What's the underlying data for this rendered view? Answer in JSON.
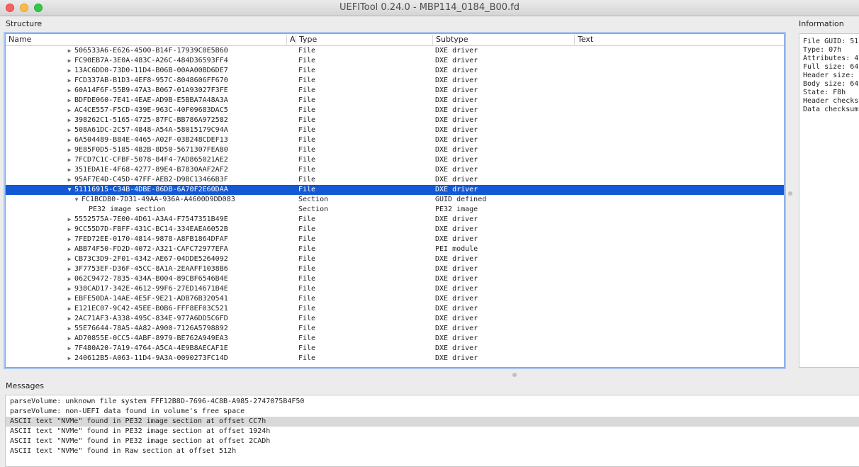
{
  "window": {
    "title": "UEFITool 0.24.0 - MBP114_0184_B00.fd"
  },
  "structure": {
    "title": "Structure",
    "columns": {
      "name": "Name",
      "a": "A",
      "type": "Type",
      "subtype": "Subtype",
      "text": "Text"
    },
    "rows": [
      {
        "name": "506533A6-E626-4500-B14F-17939C0E5B60",
        "type": "File",
        "subtype": "DXE driver",
        "level": 0,
        "arrow": "right"
      },
      {
        "name": "FC90EB7A-3E0A-483C-A26C-484D36593FF4",
        "type": "File",
        "subtype": "DXE driver",
        "level": 0,
        "arrow": "right"
      },
      {
        "name": "13AC6DD0-73D0-11D4-B06B-00AA00BD6DE7",
        "type": "File",
        "subtype": "DXE driver",
        "level": 0,
        "arrow": "right"
      },
      {
        "name": "FCD337AB-B1D3-4EF8-957C-8048606FF670",
        "type": "File",
        "subtype": "DXE driver",
        "level": 0,
        "arrow": "right"
      },
      {
        "name": "60A14F6F-55B9-47A3-B067-01A93027F3FE",
        "type": "File",
        "subtype": "DXE driver",
        "level": 0,
        "arrow": "right"
      },
      {
        "name": "BDFDE060-7E41-4EAE-AD9B-E5BBA7A48A3A",
        "type": "File",
        "subtype": "DXE driver",
        "level": 0,
        "arrow": "right"
      },
      {
        "name": "AC4CE557-F5CD-439E-963C-40F09683DAC5",
        "type": "File",
        "subtype": "DXE driver",
        "level": 0,
        "arrow": "right"
      },
      {
        "name": "398262C1-5165-4725-87FC-BB786A972582",
        "type": "File",
        "subtype": "DXE driver",
        "level": 0,
        "arrow": "right"
      },
      {
        "name": "508A61DC-2C57-4848-A54A-58015179C94A",
        "type": "File",
        "subtype": "DXE driver",
        "level": 0,
        "arrow": "right"
      },
      {
        "name": "6A504489-B84E-4465-A02F-03B248CDEF13",
        "type": "File",
        "subtype": "DXE driver",
        "level": 0,
        "arrow": "right"
      },
      {
        "name": "9E85F0D5-5185-482B-8D50-5671307FEA80",
        "type": "File",
        "subtype": "DXE driver",
        "level": 0,
        "arrow": "right"
      },
      {
        "name": "7FCD7C1C-CFBF-5078-84F4-7AD865021AE2",
        "type": "File",
        "subtype": "DXE driver",
        "level": 0,
        "arrow": "right"
      },
      {
        "name": "351EDA1E-4F68-4277-89E4-B7830AAF2AF2",
        "type": "File",
        "subtype": "DXE driver",
        "level": 0,
        "arrow": "right"
      },
      {
        "name": "95AF7E4D-C45D-47FF-AEB2-D9BC13466B3F",
        "type": "File",
        "subtype": "DXE driver",
        "level": 0,
        "arrow": "right"
      },
      {
        "name": "51116915-C34B-4DBE-86DB-6A70F2E60DAA",
        "type": "File",
        "subtype": "DXE driver",
        "level": 0,
        "arrow": "down",
        "selected": true
      },
      {
        "name": "FC1BCDB0-7D31-49AA-936A-A4600D9DD083",
        "type": "Section",
        "subtype": "GUID defined",
        "level": 1,
        "arrow": "down"
      },
      {
        "name": "PE32 image section",
        "type": "Section",
        "subtype": "PE32 image",
        "level": 2,
        "arrow": "none"
      },
      {
        "name": "5552575A-7E00-4D61-A3A4-F7547351B49E",
        "type": "File",
        "subtype": "DXE driver",
        "level": 0,
        "arrow": "right"
      },
      {
        "name": "9CC55D7D-FBFF-431C-BC14-334EAEA6052B",
        "type": "File",
        "subtype": "DXE driver",
        "level": 0,
        "arrow": "right"
      },
      {
        "name": "7FED72EE-0170-4814-9878-A8FB1864DFAF",
        "type": "File",
        "subtype": "DXE driver",
        "level": 0,
        "arrow": "right"
      },
      {
        "name": "ABB74F50-FD2D-4072-A321-CAFC72977EFA",
        "type": "File",
        "subtype": "PEI module",
        "level": 0,
        "arrow": "right"
      },
      {
        "name": "CB73C3D9-2F01-4342-AE67-04DDE5264092",
        "type": "File",
        "subtype": "DXE driver",
        "level": 0,
        "arrow": "right"
      },
      {
        "name": "3F7753EF-D36F-45CC-8A1A-2EAAFF1038B6",
        "type": "File",
        "subtype": "DXE driver",
        "level": 0,
        "arrow": "right"
      },
      {
        "name": "062C9472-7835-434A-B004-89CBF6546B4E",
        "type": "File",
        "subtype": "DXE driver",
        "level": 0,
        "arrow": "right"
      },
      {
        "name": "938CAD17-342E-4612-99F6-27ED14671B4E",
        "type": "File",
        "subtype": "DXE driver",
        "level": 0,
        "arrow": "right"
      },
      {
        "name": "EBFE50DA-14AE-4E5F-9E21-ADB76B320541",
        "type": "File",
        "subtype": "DXE driver",
        "level": 0,
        "arrow": "right"
      },
      {
        "name": "E121EC07-9C42-45EE-B0B6-FFF8EF03C521",
        "type": "File",
        "subtype": "DXE driver",
        "level": 0,
        "arrow": "right"
      },
      {
        "name": "2AC71AF3-A338-495C-834E-977A6DD5C6FD",
        "type": "File",
        "subtype": "DXE driver",
        "level": 0,
        "arrow": "right"
      },
      {
        "name": "55E76644-78A5-4A82-A900-7126A5798892",
        "type": "File",
        "subtype": "DXE driver",
        "level": 0,
        "arrow": "right"
      },
      {
        "name": "AD70855E-0CC5-4ABF-8979-BE762A949EA3",
        "type": "File",
        "subtype": "DXE driver",
        "level": 0,
        "arrow": "right"
      },
      {
        "name": "7F480A20-7A19-4764-A5CA-4E9B8AECAF1E",
        "type": "File",
        "subtype": "DXE driver",
        "level": 0,
        "arrow": "right"
      },
      {
        "name": "240612B5-A063-11D4-9A3A-0090273FC14D",
        "type": "File",
        "subtype": "DXE driver",
        "level": 0,
        "arrow": "right"
      }
    ]
  },
  "information": {
    "title": "Information",
    "lines": [
      "File GUID: 51",
      "Type: 07h",
      "Attributes: 4",
      "Full size: 64",
      "Header size:",
      "Body size: 64",
      "State: F8h",
      "Header checks",
      "Data checksum"
    ]
  },
  "messages": {
    "title": "Messages",
    "items": [
      {
        "text": "parseVolume: unknown file system FFF12B8D-7696-4C8B-A985-2747075B4F50",
        "highlighted": false
      },
      {
        "text": "parseVolume: non-UEFI data found in volume's free space",
        "highlighted": false
      },
      {
        "text": "ASCII text \"NVMe\" found in PE32 image section at offset CC7h",
        "highlighted": true
      },
      {
        "text": "ASCII text \"NVMe\" found in PE32 image section at offset 1924h",
        "highlighted": false
      },
      {
        "text": "ASCII text \"NVMe\" found in PE32 image section at offset 2CADh",
        "highlighted": false
      },
      {
        "text": "ASCII text \"NVMe\" found in Raw section at offset 512h",
        "highlighted": false
      }
    ]
  }
}
